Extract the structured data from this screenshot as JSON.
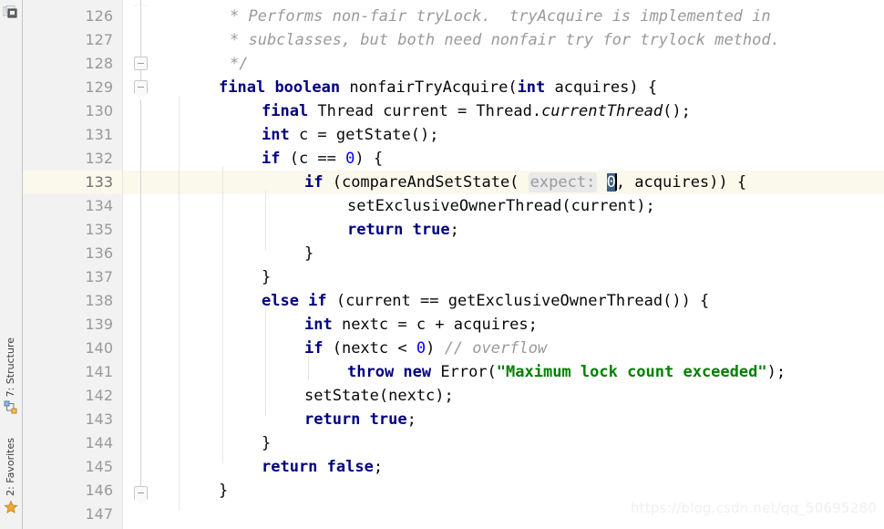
{
  "tool_window_bar": {
    "top_icon": "project-folder-icon",
    "items": [
      {
        "label": "7: Structure",
        "icon": "structure-icon"
      },
      {
        "label": "2: Favorites",
        "icon": "favorites-star-icon"
      }
    ]
  },
  "editor": {
    "first_line_number": 126,
    "current_line_number": 133,
    "line_numbers": [
      126,
      127,
      128,
      129,
      130,
      131,
      132,
      133,
      134,
      135,
      136,
      137,
      138,
      139,
      140,
      141,
      142,
      143,
      144,
      145,
      146,
      147
    ],
    "fold_markers": [
      {
        "line": 128,
        "type": "fold-collapse-square"
      },
      {
        "line": 129,
        "type": "fold-collapse-shield"
      },
      {
        "line": 146,
        "type": "fold-end-shield"
      }
    ],
    "colors": {
      "gutter_bg": "#f2f2f2",
      "editor_bg": "#ffffff",
      "current_line_bg": "#fbf8ec",
      "keyword": "#000080",
      "number": "#0000ff",
      "string": "#008000",
      "comment": "#9a9a9a",
      "selection": "#3d6185",
      "param_hint_bg": "#eaeaea"
    },
    "lines": [
      {
        "n": 126,
        "indent": 0,
        "text": " * Performs non-fair tryLock.  tryAcquire is implemented in"
      },
      {
        "n": 127,
        "indent": 0,
        "text": " * subclasses, but both need nonfair try for trylock method."
      },
      {
        "n": 128,
        "indent": 0,
        "text": " */"
      },
      {
        "n": 129,
        "indent": 0,
        "text": "final boolean nonfairTryAcquire(int acquires) {"
      },
      {
        "n": 130,
        "indent": 1,
        "text": "final Thread current = Thread.currentThread();"
      },
      {
        "n": 131,
        "indent": 1,
        "text": "int c = getState();"
      },
      {
        "n": 132,
        "indent": 1,
        "text": "if (c == 0) {"
      },
      {
        "n": 133,
        "indent": 2,
        "text": "if (compareAndSetState( expect: 0, acquires)) {"
      },
      {
        "n": 134,
        "indent": 3,
        "text": "setExclusiveOwnerThread(current);"
      },
      {
        "n": 135,
        "indent": 3,
        "text": "return true;"
      },
      {
        "n": 136,
        "indent": 2,
        "text": "}"
      },
      {
        "n": 137,
        "indent": 1,
        "text": "}"
      },
      {
        "n": 138,
        "indent": 1,
        "text": "else if (current == getExclusiveOwnerThread()) {"
      },
      {
        "n": 139,
        "indent": 2,
        "text": "int nextc = c + acquires;"
      },
      {
        "n": 140,
        "indent": 2,
        "text": "if (nextc < 0) // overflow"
      },
      {
        "n": 141,
        "indent": 3,
        "text": "throw new Error(\"Maximum lock count exceeded\");"
      },
      {
        "n": 142,
        "indent": 2,
        "text": "setState(nextc);"
      },
      {
        "n": 143,
        "indent": 2,
        "text": "return true;"
      },
      {
        "n": 144,
        "indent": 1,
        "text": "}"
      },
      {
        "n": 145,
        "indent": 1,
        "text": "return false;"
      },
      {
        "n": 146,
        "indent": 0,
        "text": "}"
      },
      {
        "n": 147,
        "indent": 0,
        "text": ""
      }
    ],
    "param_hint": "expect:",
    "selected_token": "0"
  },
  "watermark": "https://blog.csdn.net/qq_50695280"
}
